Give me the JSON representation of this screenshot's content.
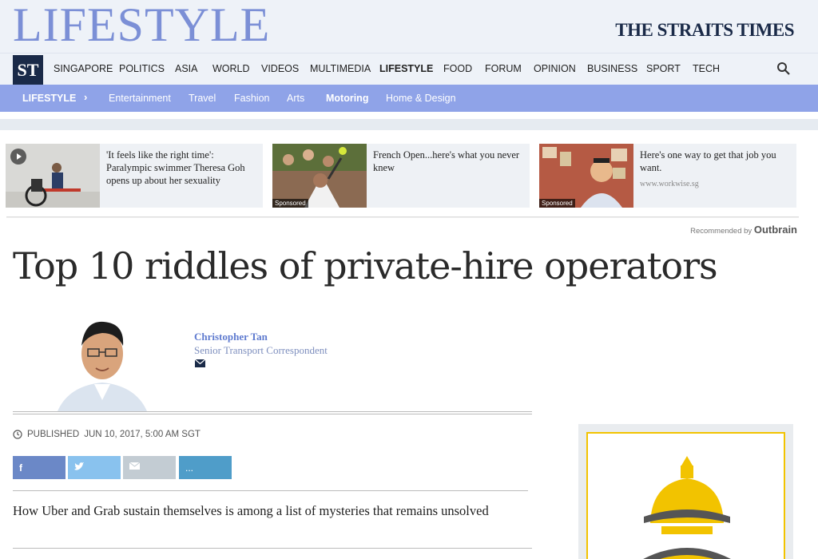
{
  "header": {
    "section_title": "LIFESTYLE",
    "masthead": "THE STRAITS TIMES",
    "logo_text": "ST"
  },
  "main_nav": {
    "items": [
      "SINGAPORE",
      "POLITICS",
      "ASIA",
      "WORLD",
      "VIDEOS",
      "MULTIMEDIA",
      "LIFESTYLE",
      "FOOD",
      "FORUM",
      "OPINION",
      "BUSINESS",
      "SPORT",
      "TECH"
    ],
    "active": "LIFESTYLE"
  },
  "sub_nav": {
    "section": "LIFESTYLE",
    "items": [
      "Entertainment",
      "Travel",
      "Fashion",
      "Arts",
      "Motoring",
      "Home & Design"
    ],
    "active": "Motoring"
  },
  "recommended": {
    "cards": [
      {
        "text": "'It feels like the right time': Paralympic swimmer Theresa Goh opens up about her sexuality",
        "source": "",
        "badge": ""
      },
      {
        "text": "French Open...here's what you never knew",
        "source": "",
        "badge": "Sponsored"
      },
      {
        "text": "Here's one way to get that job you want.",
        "source": "www.workwise.sg",
        "badge": "Sponsored"
      }
    ],
    "attribution_prefix": "Recommended by",
    "attribution_brand": "Outbrain"
  },
  "article": {
    "headline": "Top 10 riddles of private-hire operators",
    "author_name": "Christopher Tan",
    "author_role": "Senior Transport Correspondent",
    "published_label": "PUBLISHED",
    "published_date": "JUN 10, 2017, 5:00 AM SGT",
    "summary": "How Uber and Grab sustain themselves is among a list of mysteries that remains unsolved"
  },
  "share": {
    "facebook": "f",
    "twitter": "t",
    "email": "e",
    "more": "..."
  },
  "colors": {
    "brand_blue": "#8fa3e8",
    "title_blue": "#7b8fd6",
    "navy": "#1a2a48",
    "facebook": "#6b88c7",
    "twitter": "#89c2ee",
    "email": "#c3ccd3",
    "more": "#4f9dc9",
    "ad_yellow": "#f2c300"
  }
}
